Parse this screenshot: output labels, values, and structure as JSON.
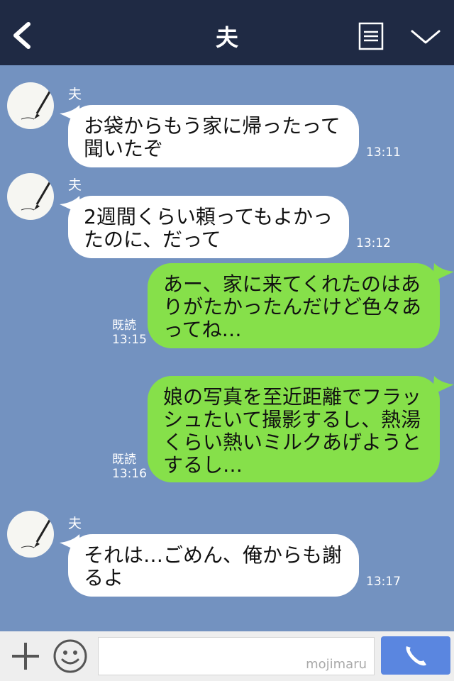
{
  "header": {
    "title": "夫"
  },
  "messages": [
    {
      "sender": "夫",
      "text": "お袋からもう家に帰ったって聞いたぞ",
      "time": "13:11",
      "direction": "in"
    },
    {
      "sender": "夫",
      "text": "2週間くらい頼ってもよかったのに、だって",
      "time": "13:12",
      "direction": "in"
    },
    {
      "read": "既読",
      "text": "あー、家に来てくれたのはありがたかったんだけど色々あってね…",
      "time": "13:15",
      "direction": "out"
    },
    {
      "read": "既読",
      "text": "娘の写真を至近距離でフラッシュたいて撮影するし、熱湯くらい熱いミルクあげようとするし…",
      "time": "13:16",
      "direction": "out"
    },
    {
      "sender": "夫",
      "text": "それは…ごめん、俺からも謝るよ",
      "time": "13:17",
      "direction": "in"
    }
  ],
  "input": {
    "watermark": "mojimaru"
  },
  "colors": {
    "header": "#1f2a44",
    "chat_bg": "#7392c0",
    "outgoing": "#86e04a",
    "incoming": "#ffffff",
    "call": "#5a86e0"
  }
}
